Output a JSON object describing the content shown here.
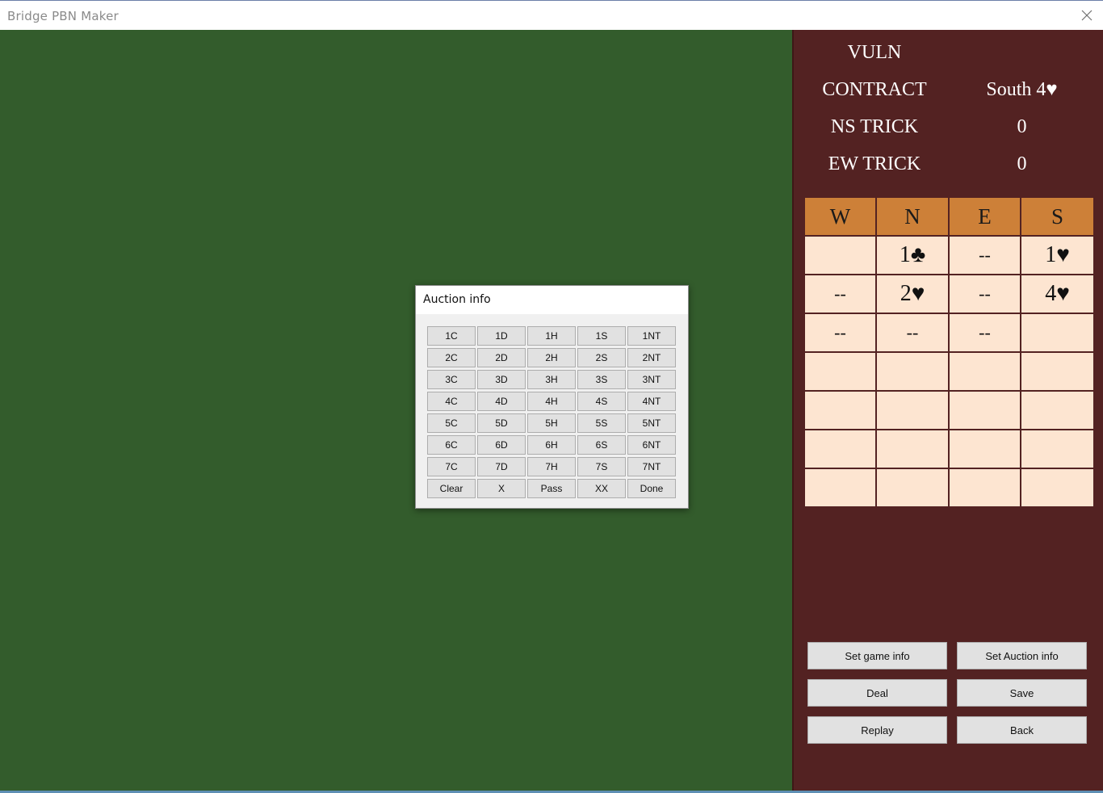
{
  "window": {
    "title": "Bridge PBN Maker",
    "close_glyph": "✕"
  },
  "game_info": {
    "vuln_label": "VULN",
    "vuln_value": "",
    "contract_label": "CONTRACT",
    "contract_value": "South 4♥",
    "ns_trick_label": "NS TRICK",
    "ns_trick_value": "0",
    "ew_trick_label": "EW TRICK",
    "ew_trick_value": "0"
  },
  "auction": {
    "headers": [
      "W",
      "N",
      "E",
      "S"
    ],
    "rows": [
      [
        "",
        "1♣",
        "--",
        "1♥"
      ],
      [
        "--",
        "2♥",
        "--",
        "4♥"
      ],
      [
        "--",
        "--",
        "--",
        ""
      ],
      [
        "",
        "",
        "",
        ""
      ],
      [
        "",
        "",
        "",
        ""
      ],
      [
        "",
        "",
        "",
        ""
      ],
      [
        "",
        "",
        "",
        ""
      ]
    ]
  },
  "buttons": {
    "set_game_info": "Set game info",
    "set_auction_info": "Set Auction info",
    "deal": "Deal",
    "save": "Save",
    "replay": "Replay",
    "back": "Back"
  },
  "auction_dialog": {
    "title": "Auction info",
    "bids": [
      [
        "1C",
        "1D",
        "1H",
        "1S",
        "1NT"
      ],
      [
        "2C",
        "2D",
        "2H",
        "2S",
        "2NT"
      ],
      [
        "3C",
        "3D",
        "3H",
        "3S",
        "3NT"
      ],
      [
        "4C",
        "4D",
        "4H",
        "4S",
        "4NT"
      ],
      [
        "5C",
        "5D",
        "5H",
        "5S",
        "5NT"
      ],
      [
        "6C",
        "6D",
        "6H",
        "6S",
        "6NT"
      ],
      [
        "7C",
        "7D",
        "7H",
        "7S",
        "7NT"
      ],
      [
        "Clear",
        "X",
        "Pass",
        "XX",
        "Done"
      ]
    ]
  },
  "colors": {
    "felt": "#335c2c",
    "panel": "#532222",
    "grid_header": "#cd8038",
    "grid_cell": "#fde5d1"
  }
}
